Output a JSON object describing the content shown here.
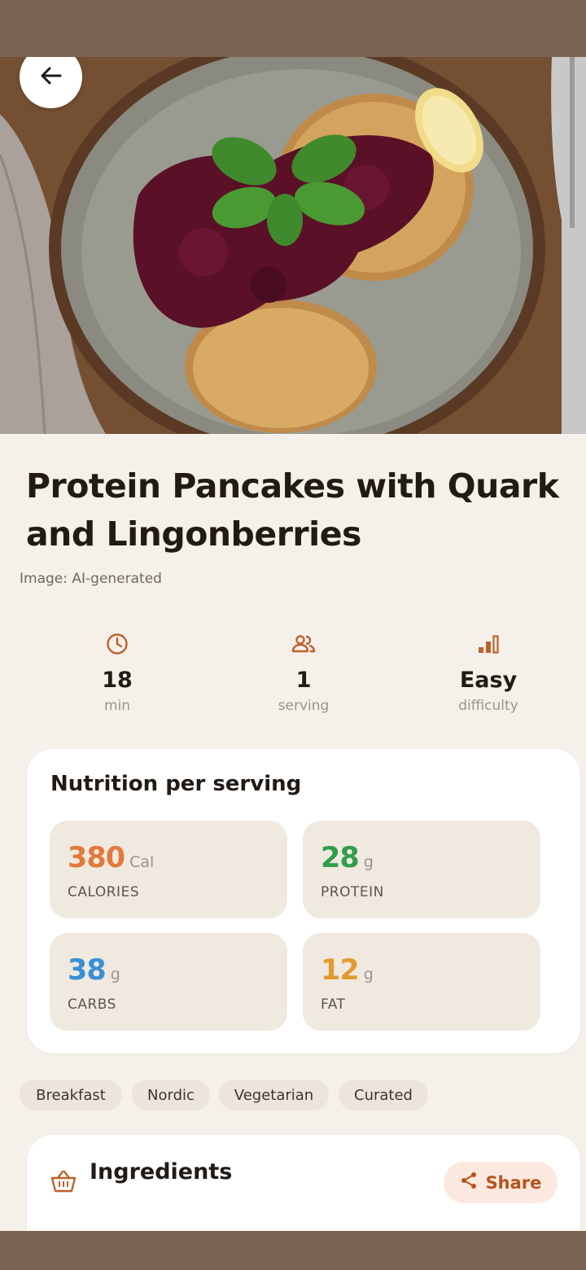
{
  "recipe": {
    "title": "Protein Pancakes with Quark and Lingonberries",
    "image_caption": "Image: AI-generated"
  },
  "stats": [
    {
      "icon": "clock-icon",
      "value": "18",
      "label": "min"
    },
    {
      "icon": "people-icon",
      "value": "1",
      "label": "serving"
    },
    {
      "icon": "signal-bars-icon",
      "value": "Easy",
      "label": "difficulty"
    }
  ],
  "nutrition": {
    "heading": "Nutrition per serving",
    "items": [
      {
        "value": "380",
        "unit": "Cal",
        "label": "CALORIES",
        "color": "#e07a3c"
      },
      {
        "value": "28",
        "unit": "g",
        "label": "PROTEIN",
        "color": "#2f9e4a"
      },
      {
        "value": "38",
        "unit": "g",
        "label": "CARBS",
        "color": "#3a8fd6"
      },
      {
        "value": "12",
        "unit": "g",
        "label": "FAT",
        "color": "#e39a2f"
      }
    ]
  },
  "tags": [
    "Breakfast",
    "Nordic",
    "Vegetarian",
    "Curated"
  ],
  "ingredients": {
    "heading": "Ingredients",
    "share_label": "Share"
  },
  "colors": {
    "accent": "#c0612b",
    "background": "#f5f0ea",
    "status_bar": "#7a6552"
  }
}
